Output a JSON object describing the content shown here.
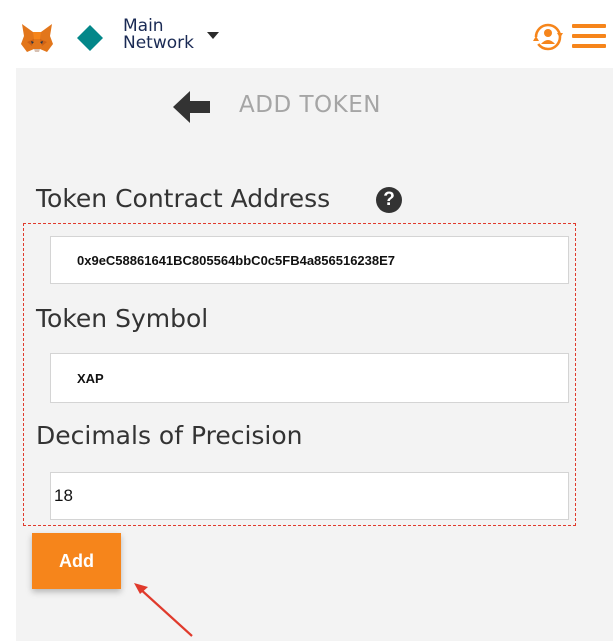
{
  "header": {
    "network_line1": "Main",
    "network_line2": "Network"
  },
  "page": {
    "title": "ADD TOKEN"
  },
  "form": {
    "address_label": "Token Contract Address",
    "address_value": "0x9eC58861641BC805564bbC0c5FB4a856516238E7",
    "symbol_label": "Token Symbol",
    "symbol_value": "XAP",
    "decimals_label": "Decimals of Precision",
    "decimals_value": "18",
    "add_label": "Add"
  },
  "colors": {
    "accent": "#f6851b",
    "network_diamond": "#038789",
    "annotation": "#e03a2c"
  },
  "icons": [
    "metamask-fox-icon",
    "network-diamond-icon",
    "account-switch-icon",
    "hamburger-menu-icon",
    "back-arrow-icon",
    "help-icon"
  ]
}
